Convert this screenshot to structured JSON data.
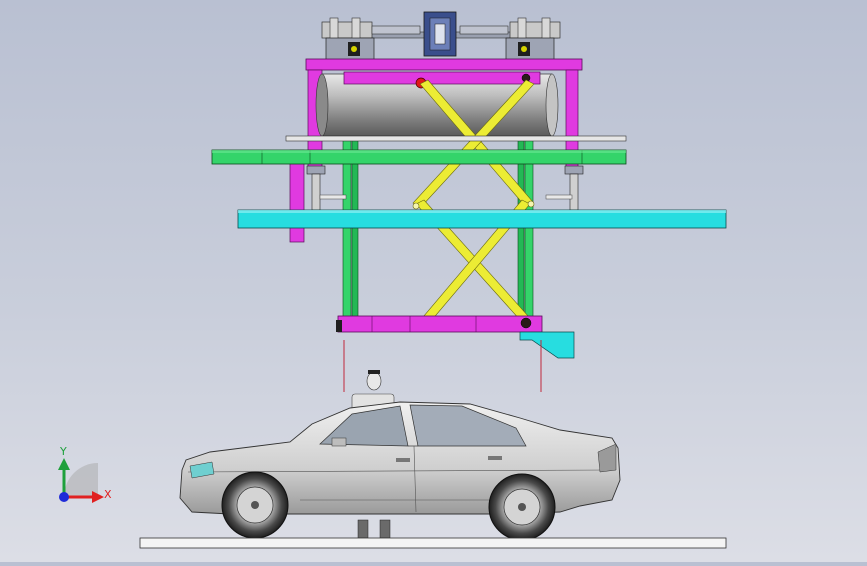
{
  "view": {
    "type": "cad-3d-viewport",
    "background_top": "#b9c0d2",
    "background_bottom": "#dcdee6"
  },
  "triad": {
    "x_label": "X",
    "y_label": "Y",
    "x_color": "#e02020",
    "y_color": "#1ea03c",
    "z_color": "#1e2ad8"
  },
  "model": {
    "components": [
      "drive-motor-assembly",
      "top-frame",
      "cylinder-tank",
      "scissor-lift",
      "green-platform",
      "cyan-platform",
      "carriage-base",
      "car",
      "person",
      "ground-slab"
    ],
    "colors": {
      "magenta": "#e03ae0",
      "green": "#34d46a",
      "cyan": "#27dde0",
      "yellow": "#ecec34",
      "steel": "#b4b4b4"
    }
  }
}
